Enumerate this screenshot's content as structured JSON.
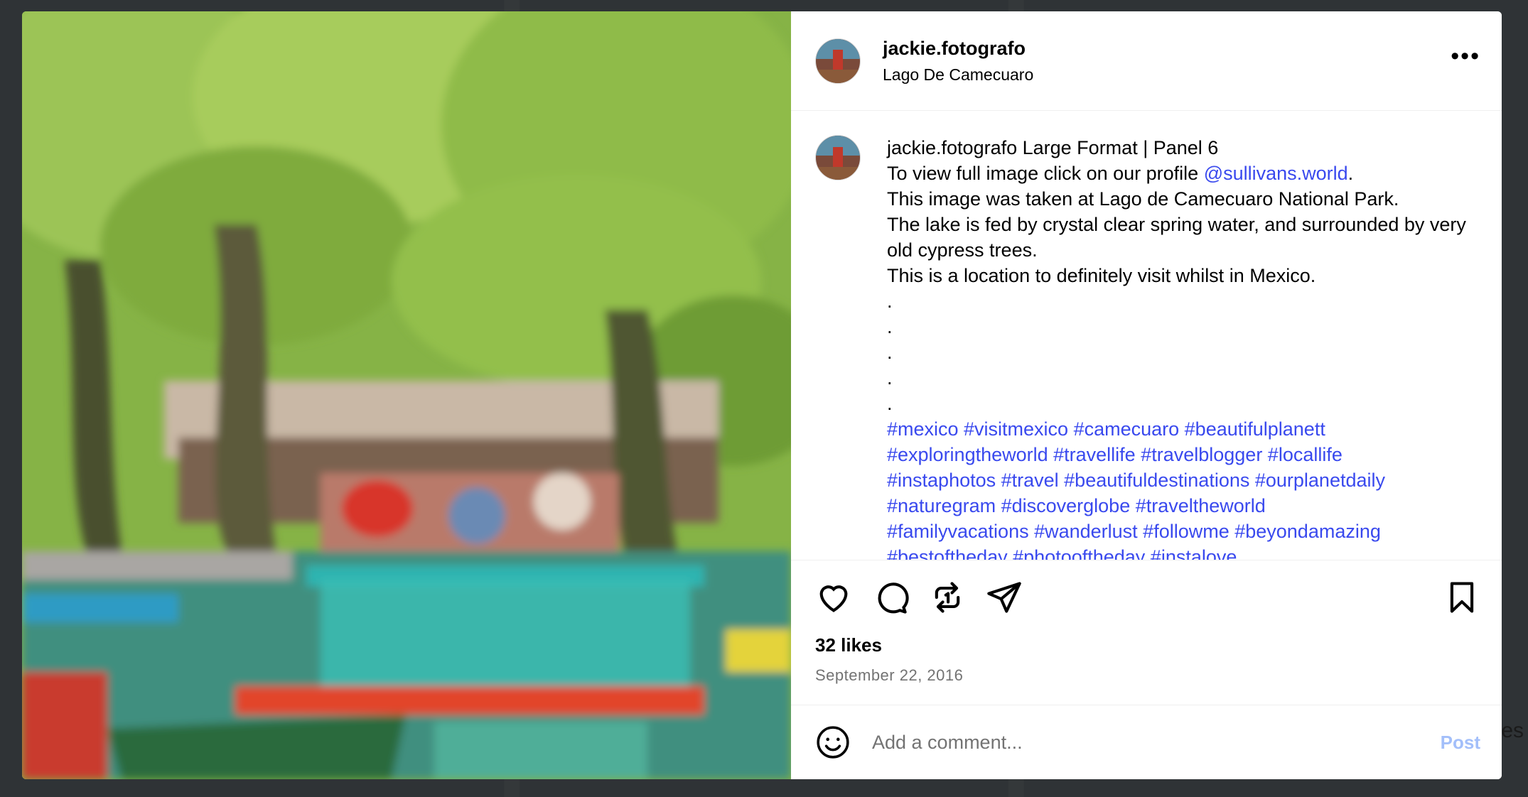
{
  "post": {
    "username": "jackie.fotografo",
    "location": "Lago De Camecuaro",
    "more_label": "•••",
    "caption": {
      "author": "jackie.fotografo",
      "line1": "Large Format | Panel 6",
      "line2_before": "To view full image click on our profile ",
      "line2_link": "@sullivans.world",
      "line2_after": ".",
      "line3": "This image was taken at Lago de Camecuaro National Park.",
      "line4": "The lake is fed by crystal clear spring water, and surrounded by very old cypress trees.",
      "line5": "This is a location to definitely visit whilst in Mexico.",
      "dots": [
        ".",
        ".",
        ".",
        ".",
        "."
      ],
      "hashtags": [
        "#mexico #visitmexico #camecuaro #beautifulplanett",
        "#exploringtheworld #travellife #travelblogger #locallife",
        "#instaphotos #travel #beautifuldestinations #ourplanetdaily",
        "#naturegram #discoverglobe #traveltheworld",
        "#familyvacations #wanderlust #followme #beyondamazing",
        "#bestoftheday #photooftheday #instalove"
      ]
    },
    "likes": "32 likes",
    "date": "September 22, 2016",
    "comment_placeholder": "Add a comment...",
    "post_label": "Post"
  },
  "icons": {
    "like": "heart-icon",
    "comment": "comment-icon",
    "repost": "repost-icon",
    "share": "share-icon",
    "save": "bookmark-icon",
    "emoji": "smile-icon",
    "more": "more-icon"
  },
  "colors": {
    "link": "#3949ee",
    "post_button": "#a3bffa",
    "date": "#737373"
  },
  "background": {
    "partial_text": "es"
  }
}
